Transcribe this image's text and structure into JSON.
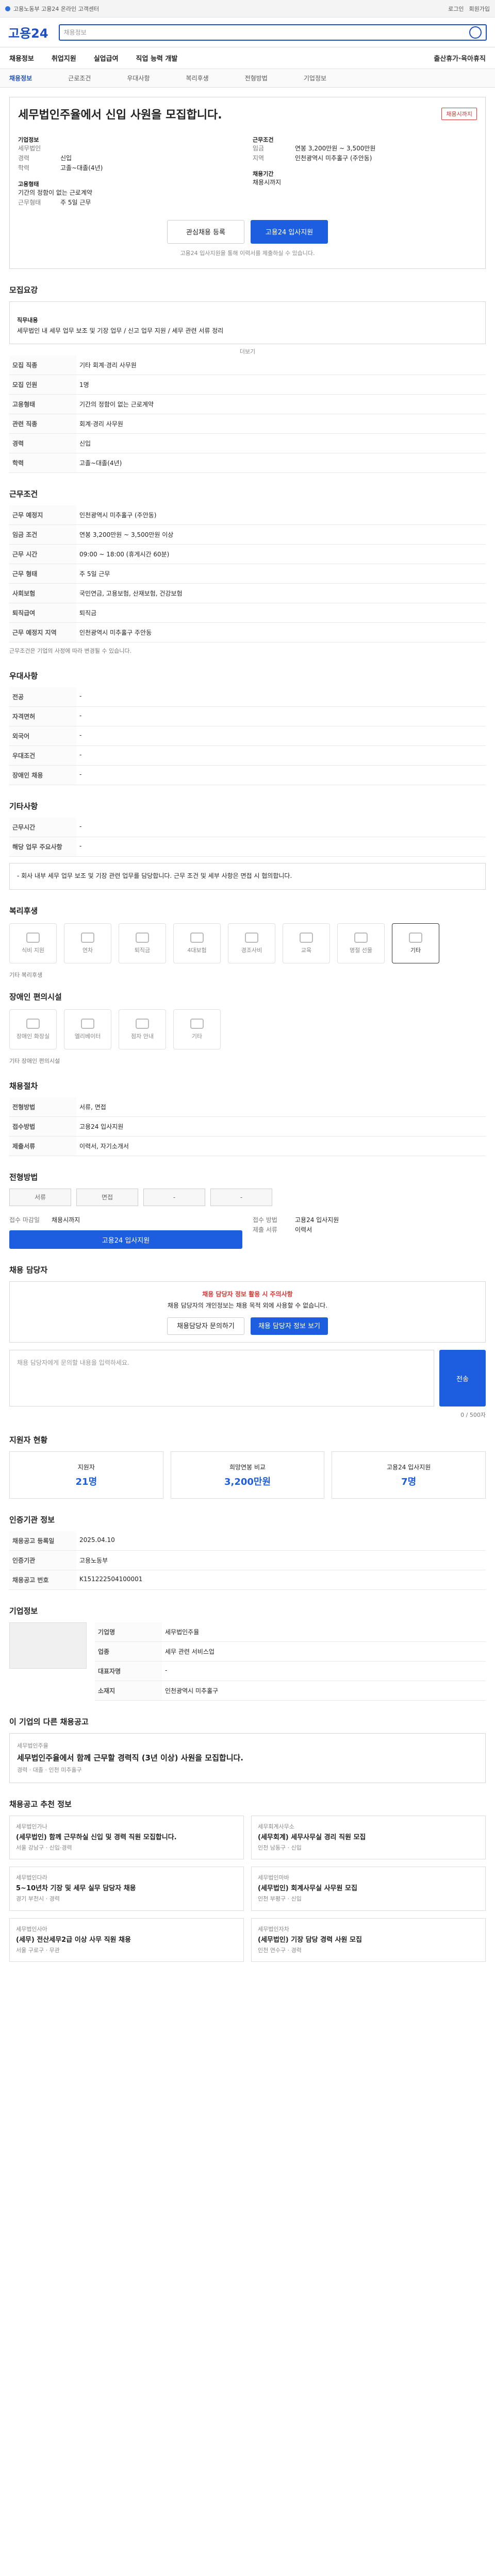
{
  "topbar": {
    "left": "고용노동부 고용24 온라인 고객센터",
    "right1": "로그인",
    "right2": "회원가입"
  },
  "header": {
    "logo": "고용24",
    "search_placeholder": "채용정보"
  },
  "gnb": [
    "채용정보",
    "취업지원",
    "실업급여",
    "직업 능력 개발",
    "출산휴가·육아휴직"
  ],
  "subtabs": [
    "채용정보",
    "근로조건",
    "우대사항",
    "복리후생",
    "전형방법",
    "기업정보"
  ],
  "job": {
    "title": "세무법인주율에서 신입 사원을 모집합니다.",
    "badge": "채용시까지",
    "company_label": "기업정보",
    "company": "세무법인",
    "condition_label": "근무조건",
    "career_k": "경력",
    "career_v": "신입",
    "edu_k": "학력",
    "edu_v": "고졸~대졸(4년)",
    "salary_k": "임금",
    "salary_v": "연봉 3,200만원 ~ 3,500만원",
    "region_k": "지역",
    "region_v": "인천광역시 미추홀구 (주안동)",
    "type_label": "고용형태",
    "type_v": "기간의 정함이 없는 근로계약",
    "hours_k": "근무형태",
    "hours_v": "주 5일 근무",
    "deadline_label": "채용기간",
    "deadline_v": "채용시까지"
  },
  "buttons": {
    "interest": "관심채용 등록",
    "apply": "고용24 입사지원",
    "note": "고용24 입사지원을 통해 이력서를 제출하실 수 있습니다."
  },
  "recruit": {
    "heading": "모집요강",
    "duty_label": "직무내용",
    "duty_text": "세무법인 내 세무 업무 보조 및 기장 업무 / 신고 업무 지원 / 세무 관련 서류 정리",
    "more": "더보기",
    "rows": [
      {
        "k": "모집 직종",
        "v": "기타 회계·경리 사무원"
      },
      {
        "k": "모집 인원",
        "v": "1명"
      },
      {
        "k": "고용형태",
        "v": "기간의 정함이 없는 근로계약"
      },
      {
        "k": "관련 직종",
        "v": "회계·경리 사무원"
      },
      {
        "k": "경력",
        "v": "신입"
      },
      {
        "k": "학력",
        "v": "고졸~대졸(4년)"
      }
    ]
  },
  "conditions": {
    "heading": "근무조건",
    "rows": [
      {
        "k": "근무 예정지",
        "v": "인천광역시 미추홀구 (주안동)"
      },
      {
        "k": "임금 조건",
        "v": "연봉 3,200만원 ~ 3,500만원 이상"
      },
      {
        "k": "근무 시간",
        "v": "09:00 ~ 18:00 (휴게시간 60분)"
      },
      {
        "k": "근무 형태",
        "v": "주 5일 근무"
      },
      {
        "k": "사회보험",
        "v": "국민연금, 고용보험, 산재보험, 건강보험"
      },
      {
        "k": "퇴직급여",
        "v": "퇴직금"
      },
      {
        "k": "근무 예정지 지역",
        "v": "인천광역시 미추홀구 주안동"
      }
    ],
    "note": "근무조건은 기업의 사정에 따라 변경될 수 있습니다."
  },
  "preference": {
    "heading": "우대사항",
    "rows": [
      {
        "k": "전공",
        "v": "-"
      },
      {
        "k": "자격면허",
        "v": "-"
      },
      {
        "k": "외국어",
        "v": "-"
      },
      {
        "k": "우대조건",
        "v": "-"
      },
      {
        "k": "장애인 채용",
        "v": "-"
      }
    ]
  },
  "other": {
    "heading": "기타사항",
    "rows": [
      {
        "k": "근무시간",
        "v": "-"
      },
      {
        "k": "해당 업무 주요사항",
        "v": "-"
      }
    ],
    "text": "- 회사 내부 세무 업무 보조 및 기장 관련 업무를 담당합니다. 근무 조건 및 세부 사항은 면접 시 협의합니다."
  },
  "welfare": {
    "heading": "복리후생",
    "items": [
      "식비 지원",
      "연차",
      "퇴직금",
      "4대보험",
      "경조사비",
      "교육",
      "명절 선물",
      "기타"
    ],
    "note": "기타 복리후생",
    "disabled_heading": "장애인 편의시설",
    "disabled_items": [
      "장애인 화장실",
      "엘리베이터",
      "점자 안내",
      "기타"
    ],
    "disabled_note": "기타 장애인 편의시설"
  },
  "process": {
    "heading": "채용절차",
    "rows": [
      {
        "k": "전형방법",
        "v": "서류, 면접"
      },
      {
        "k": "접수방법",
        "v": "고용24 입사지원"
      },
      {
        "k": "제출서류",
        "v": "이력서, 자기소개서"
      }
    ]
  },
  "method": {
    "heading": "전형방법",
    "tags": [
      "서류",
      "면접",
      "-",
      "-"
    ],
    "apply_k": "접수 마감일",
    "apply_v": "채용시까지",
    "apply2_k": "접수 방법",
    "apply2_v": "고용24 입사지원",
    "apply_btn": "고용24 입사지원",
    "doc_k": "제출 서류",
    "doc_v": "이력서"
  },
  "manager": {
    "heading": "채용 담당자",
    "warn": "채용 담당자 정보 활용 시 주의사항",
    "text": "채용 담당자의 개인정보는 채용 목적 외에 사용할 수 없습니다.",
    "btn1": "채용담당자 문의하기",
    "btn2": "채용 담당자 정보 보기"
  },
  "inquiry": {
    "placeholder": "채용 담당자에게 문의할 내용을 입력하세요.",
    "count": "0 / 500자",
    "submit": "전송"
  },
  "stats": {
    "heading": "지원자 현황",
    "items": [
      {
        "k": "지원자",
        "v": "21명"
      },
      {
        "k": "희망연봉 비교",
        "v": "3,200만원"
      },
      {
        "k": "고용24 입사지원",
        "v": "7명"
      }
    ]
  },
  "registry": {
    "heading": "인증기관 정보",
    "rows": [
      {
        "k": "채용공고 등록일",
        "v": "2025.04.10"
      },
      {
        "k": "인증기관",
        "v": "고용노동부"
      },
      {
        "k": "채용공고 번호",
        "v": "K151222504100001"
      }
    ]
  },
  "company": {
    "heading": "기업정보",
    "rows": [
      {
        "k": "기업명",
        "v": "세무법인주율"
      },
      {
        "k": "업종",
        "v": "세무 관련 서비스업"
      },
      {
        "k": "대표자명",
        "v": "-"
      },
      {
        "k": "소재지",
        "v": "인천광역시 미추홀구"
      }
    ]
  },
  "similar": {
    "heading": "이 기업의 다른 채용공고",
    "featured_co": "세무법인주율",
    "featured_title": "세무법인주율에서 함께 근무할 경력직 (3년 이상) 사원을 모집합니다.",
    "featured_meta": "경력 · 대졸 · 인천 미추홀구"
  },
  "recommend": {
    "heading": "채용공고 추천 정보",
    "jobs": [
      {
        "co": "세무법인가나",
        "title": "(세무법인) 함께 근무하실 신입 및 경력 직원 모집합니다.",
        "meta": "서울 강남구 · 신입·경력"
      },
      {
        "co": "세무회계사무소",
        "title": "(세무회계) 세무사무실 경리 직원 모집",
        "meta": "인천 남동구 · 신입"
      },
      {
        "co": "세무법인다라",
        "title": "5~10년차 기장 및 세무 실무 담당자 채용",
        "meta": "경기 부천시 · 경력"
      },
      {
        "co": "세무법인마바",
        "title": "(세무법인) 회계사무실 사무원 모집",
        "meta": "인천 부평구 · 신입"
      },
      {
        "co": "세무법인사아",
        "title": "(세무) 전산세무2급 이상 사무 직원 채용",
        "meta": "서울 구로구 · 무관"
      },
      {
        "co": "세무법인자차",
        "title": "(세무법인) 기장 담당 경력 사원 모집",
        "meta": "인천 연수구 · 경력"
      }
    ]
  }
}
